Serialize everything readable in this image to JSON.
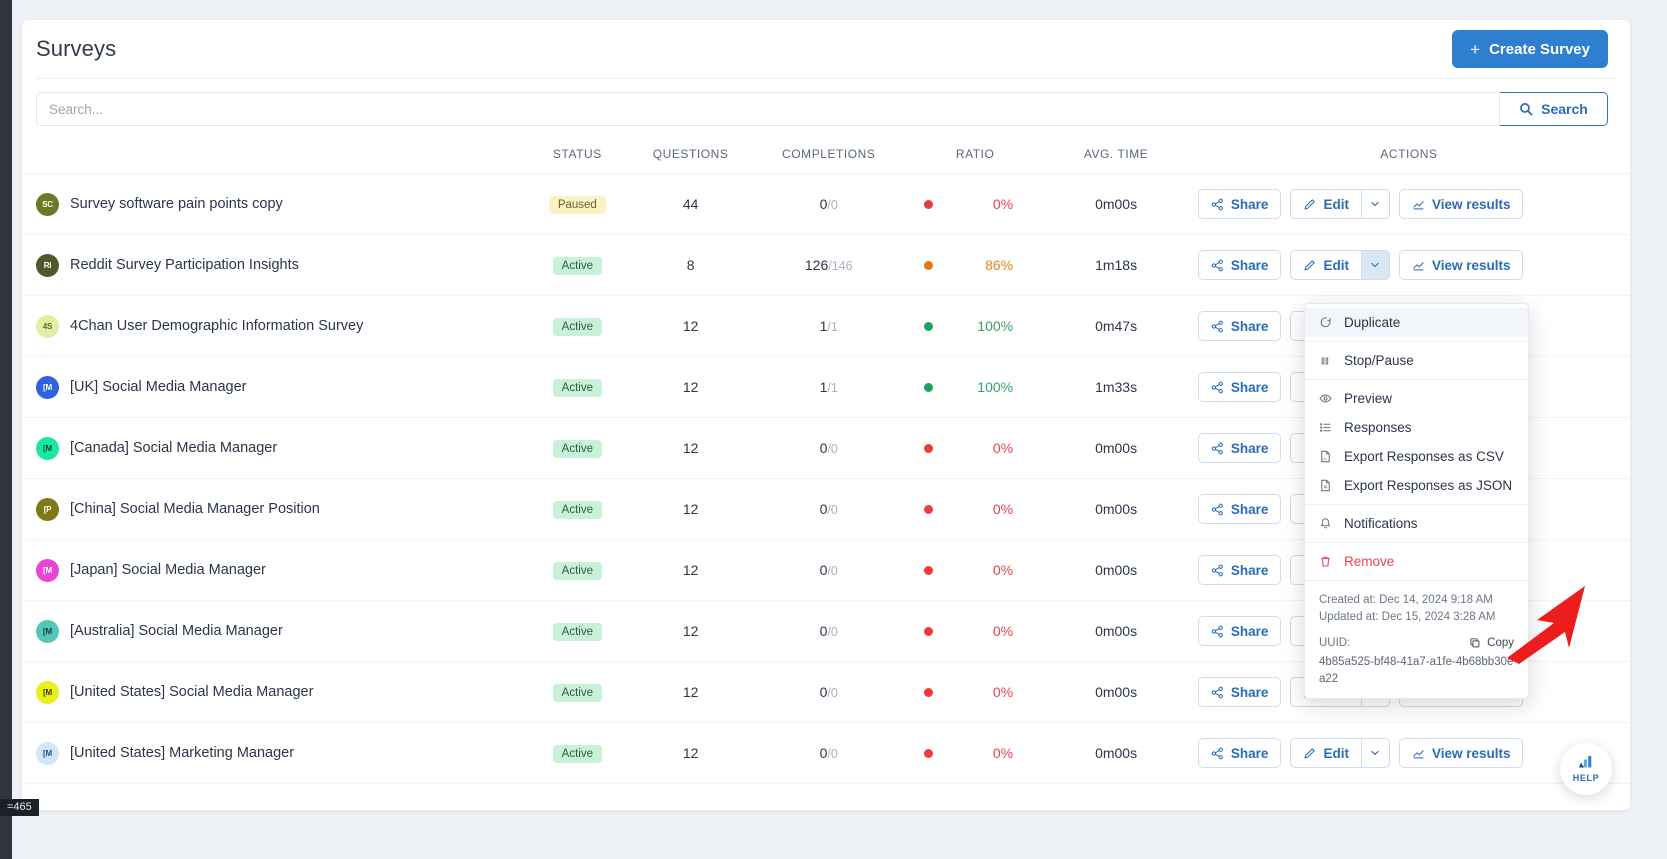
{
  "header": {
    "title": "Surveys",
    "create_button": "Create Survey",
    "create_icon": "plus-icon"
  },
  "search": {
    "placeholder": "Search...",
    "value": "",
    "button_label": "Search",
    "button_icon": "search-icon"
  },
  "table": {
    "columns": [
      "",
      "STATUS",
      "QUESTIONS",
      "COMPLETIONS",
      "RATIO",
      "AVG. TIME",
      "ACTIONS"
    ],
    "action_labels": {
      "share": "Share",
      "edit": "Edit",
      "view_results": "View results"
    },
    "rows": [
      {
        "avatar": "SC",
        "avatar_color": "#6b7a28",
        "name": "Survey software pain points copy",
        "status": "Paused",
        "status_kind": "paused",
        "questions": "44",
        "completions": "0",
        "completions_total": "0",
        "ratio": "0%",
        "ratio_color": "#e8444f",
        "dot_color": "#ef3b3b",
        "avg_time": "0m00s",
        "has_caret": true
      },
      {
        "avatar": "RI",
        "avatar_color": "#4f5a2a",
        "name": "Reddit Survey Participation Insights",
        "status": "Active",
        "status_kind": "active",
        "questions": "8",
        "completions": "126",
        "completions_total": "146",
        "ratio": "86%",
        "ratio_color": "#e08421",
        "dot_color": "#e2780f",
        "avg_time": "1m18s",
        "has_caret": true
      },
      {
        "avatar": "4S",
        "avatar_color": "#e1efa4",
        "avatar_text_color": "#5d6b2b",
        "name": "4Chan User Demographic Information Survey",
        "status": "Active",
        "status_kind": "active",
        "questions": "12",
        "completions": "1",
        "completions_total": "1",
        "ratio": "100%",
        "ratio_color": "#35a06a",
        "dot_color": "#1fa05e",
        "avg_time": "0m47s",
        "has_caret": true
      },
      {
        "avatar": "[M",
        "avatar_color": "#2e62e0",
        "name": "[UK] Social Media Manager",
        "status": "Active",
        "status_kind": "active",
        "questions": "12",
        "completions": "1",
        "completions_total": "1",
        "ratio": "100%",
        "ratio_color": "#35a06a",
        "dot_color": "#1fa05e",
        "avg_time": "1m33s",
        "has_caret": true
      },
      {
        "avatar": "[M",
        "avatar_color": "#19e9a0",
        "avatar_text_color": "#0d4a36",
        "name": "[Canada] Social Media Manager",
        "status": "Active",
        "status_kind": "active",
        "questions": "12",
        "completions": "0",
        "completions_total": "0",
        "ratio": "0%",
        "ratio_color": "#e8444f",
        "dot_color": "#ef3b3b",
        "avg_time": "0m00s",
        "has_caret": true
      },
      {
        "avatar": "[P",
        "avatar_color": "#7c7a14",
        "name": "[China] Social Media Manager Position",
        "status": "Active",
        "status_kind": "active",
        "questions": "12",
        "completions": "0",
        "completions_total": "0",
        "ratio": "0%",
        "ratio_color": "#e8444f",
        "dot_color": "#ef3b3b",
        "avg_time": "0m00s",
        "has_caret": true
      },
      {
        "avatar": "[M",
        "avatar_color": "#e845d6",
        "name": "[Japan] Social Media Manager",
        "status": "Active",
        "status_kind": "active",
        "questions": "12",
        "completions": "0",
        "completions_total": "0",
        "ratio": "0%",
        "ratio_color": "#e8444f",
        "dot_color": "#ef3b3b",
        "avg_time": "0m00s",
        "has_caret": true
      },
      {
        "avatar": "[M",
        "avatar_color": "#53c7b8",
        "avatar_text_color": "#10443e",
        "name": "[Australia] Social Media Manager",
        "status": "Active",
        "status_kind": "active",
        "questions": "12",
        "completions": "0",
        "completions_total": "0",
        "ratio": "0%",
        "ratio_color": "#e8444f",
        "dot_color": "#ef3b3b",
        "avg_time": "0m00s",
        "has_caret": true
      },
      {
        "avatar": "[M",
        "avatar_color": "#e8ef1b",
        "avatar_text_color": "#3b3f06",
        "name": "[United States] Social Media Manager",
        "status": "Active",
        "status_kind": "active",
        "questions": "12",
        "completions": "0",
        "completions_total": "0",
        "ratio": "0%",
        "ratio_color": "#e8444f",
        "dot_color": "#ef3b3b",
        "avg_time": "0m00s",
        "has_caret": true
      },
      {
        "avatar": "[M",
        "avatar_color": "#cfe6fb",
        "avatar_text_color": "#2b4f7a",
        "name": "[United States] Marketing Manager",
        "status": "Active",
        "status_kind": "active",
        "questions": "12",
        "completions": "0",
        "completions_total": "0",
        "ratio": "0%",
        "ratio_color": "#e8444f",
        "dot_color": "#ef3b3b",
        "avg_time": "0m00s",
        "has_caret": true
      }
    ]
  },
  "dropdown": {
    "open_for_row": 1,
    "items": [
      {
        "label": "Duplicate",
        "icon": "duplicate-icon",
        "highlighted": true
      },
      {
        "label": "Stop/Pause",
        "icon": "pause-icon"
      },
      {
        "label": "Preview",
        "icon": "eye-icon"
      },
      {
        "label": "Responses",
        "icon": "list-icon"
      },
      {
        "label": "Export Responses as CSV",
        "icon": "csv-file-icon"
      },
      {
        "label": "Export Responses as JSON",
        "icon": "json-file-icon"
      },
      {
        "label": "Notifications",
        "icon": "bell-icon"
      },
      {
        "label": "Remove",
        "icon": "trash-icon",
        "danger": true
      }
    ],
    "created_at": "Created at: Dec 14, 2024 9:18 AM",
    "updated_at": "Updated at: Dec 15, 2024 3:28 AM",
    "uuid_label": "UUID:",
    "copy_label": "Copy",
    "copy_icon": "copy-icon",
    "uuid_value": "4b85a525-bf48-41a7-a1fe-4b68bb30ea22"
  },
  "help_widget": {
    "label": "HELP",
    "icon": "help-chart-icon"
  },
  "status_chip": {
    "text": "=465"
  },
  "colors": {
    "accent": "#2f7fd1",
    "link": "#2b6cb8",
    "danger": "#e8444f",
    "success": "#1fa05e",
    "warning": "#e2780f",
    "page_bg": "#eef2f7"
  }
}
